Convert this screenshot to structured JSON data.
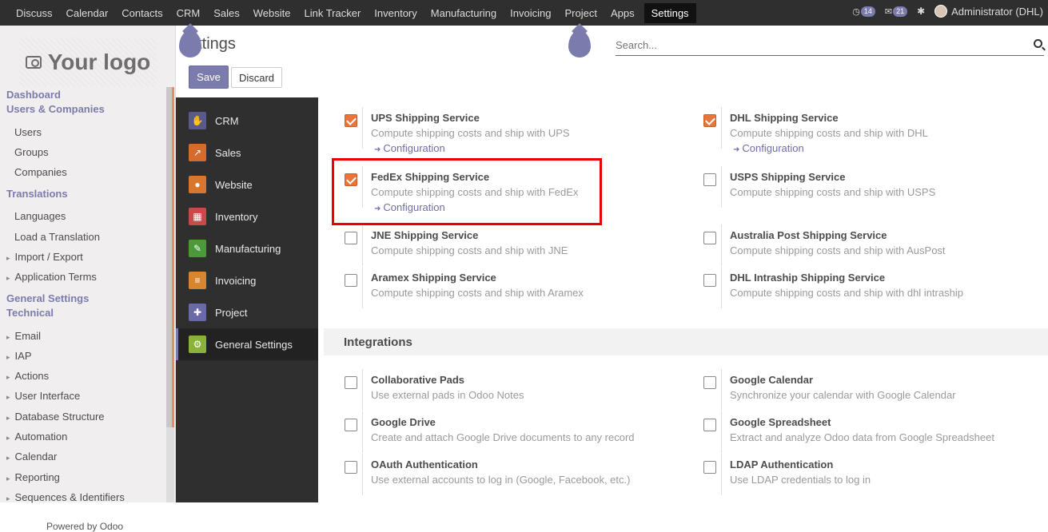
{
  "topnav": [
    "Discuss",
    "Calendar",
    "Contacts",
    "CRM",
    "Sales",
    "Website",
    "Link Tracker",
    "Inventory",
    "Manufacturing",
    "Invoicing",
    "Project",
    "Apps",
    "Settings"
  ],
  "topright": {
    "badge1": "14",
    "badge2": "21",
    "user": "Administrator (DHL)"
  },
  "logo_text": "Your logo",
  "leftmenu": [
    {
      "label": "Dashboard",
      "kind": "sec"
    },
    {
      "label": "Users & Companies",
      "kind": "sec"
    },
    {
      "label": "Users",
      "kind": "sub"
    },
    {
      "label": "Groups",
      "kind": "sub"
    },
    {
      "label": "Companies",
      "kind": "sub"
    },
    {
      "label": "Translations",
      "kind": "sec"
    },
    {
      "label": "Languages",
      "kind": "sub"
    },
    {
      "label": "Load a Translation",
      "kind": "sub"
    },
    {
      "label": "Import / Export",
      "kind": "caret"
    },
    {
      "label": "Application Terms",
      "kind": "caret"
    },
    {
      "label": "General Settings",
      "kind": "sec"
    },
    {
      "label": "Technical",
      "kind": "sec"
    },
    {
      "label": "Email",
      "kind": "caret"
    },
    {
      "label": "IAP",
      "kind": "caret"
    },
    {
      "label": "Actions",
      "kind": "caret"
    },
    {
      "label": "User Interface",
      "kind": "caret"
    },
    {
      "label": "Database Structure",
      "kind": "caret"
    },
    {
      "label": "Automation",
      "kind": "caret"
    },
    {
      "label": "Calendar",
      "kind": "caret"
    },
    {
      "label": "Reporting",
      "kind": "caret"
    },
    {
      "label": "Sequences & Identifiers",
      "kind": "caret"
    }
  ],
  "footer": "Powered by Odoo",
  "page_title": "ettings",
  "buttons": {
    "save": "Save",
    "discard": "Discard"
  },
  "search": {
    "placeholder": "Search..."
  },
  "apps": [
    {
      "label": "CRM",
      "color": "#5a5a8a",
      "icon": "handshake-icon",
      "glyph": "✋"
    },
    {
      "label": "Sales",
      "color": "#d56b2d",
      "icon": "chart-icon",
      "glyph": "↗"
    },
    {
      "label": "Website",
      "color": "#d8752f",
      "icon": "globe-icon",
      "glyph": "●"
    },
    {
      "label": "Inventory",
      "color": "#c94a4a",
      "icon": "box-icon",
      "glyph": "▦"
    },
    {
      "label": "Manufacturing",
      "color": "#4a9a3a",
      "icon": "wrench-icon",
      "glyph": "✎"
    },
    {
      "label": "Invoicing",
      "color": "#d8852f",
      "icon": "invoice-icon",
      "glyph": "≡"
    },
    {
      "label": "Project",
      "color": "#6a6aa8",
      "icon": "puzzle-icon",
      "glyph": "✚"
    },
    {
      "label": "General Settings",
      "color": "#8ab23a",
      "icon": "gear-icon",
      "glyph": "⚙",
      "active": true
    }
  ],
  "shipping": [
    {
      "title": "UPS Shipping Service",
      "desc": "Compute shipping costs and ship with UPS",
      "checked": true,
      "link": "Configuration"
    },
    {
      "title": "DHL Shipping Service",
      "desc": "Compute shipping costs and ship with DHL",
      "checked": true,
      "link": "Configuration"
    },
    {
      "title": "FedEx Shipping Service",
      "desc": "Compute shipping costs and ship with FedEx",
      "checked": true,
      "link": "Configuration"
    },
    {
      "title": "USPS Shipping Service",
      "desc": "Compute shipping costs and ship with USPS",
      "checked": false
    },
    {
      "title": "JNE Shipping Service",
      "desc": "Compute shipping costs and ship with JNE",
      "checked": false
    },
    {
      "title": "Australia Post Shipping Service",
      "desc": "Compute shipping costs and ship with AusPost",
      "checked": false
    },
    {
      "title": "Aramex Shipping Service",
      "desc": "Compute shipping costs and ship with Aramex",
      "checked": false
    },
    {
      "title": "DHL Intraship Shipping Service",
      "desc": "Compute shipping costs and ship with dhl intraship",
      "checked": false
    }
  ],
  "integrations_title": "Integrations",
  "integrations": [
    {
      "title": "Collaborative Pads",
      "desc": "Use external pads in Odoo Notes",
      "checked": false
    },
    {
      "title": "Google Calendar",
      "desc": "Synchronize your calendar with Google Calendar",
      "checked": false
    },
    {
      "title": "Google Drive",
      "desc": "Create and attach Google Drive documents to any record",
      "checked": false
    },
    {
      "title": "Google Spreadsheet",
      "desc": "Extract and analyze Odoo data from Google Spreadsheet",
      "checked": false
    },
    {
      "title": "OAuth Authentication",
      "desc": "Use external accounts to log in (Google, Facebook, etc.)",
      "checked": false
    },
    {
      "title": "LDAP Authentication",
      "desc": "Use LDAP credentials to log in",
      "checked": false
    }
  ],
  "colors": {
    "accent": "#7c7bad",
    "checkbox": "#e8763a",
    "highlight": "#e00000"
  }
}
